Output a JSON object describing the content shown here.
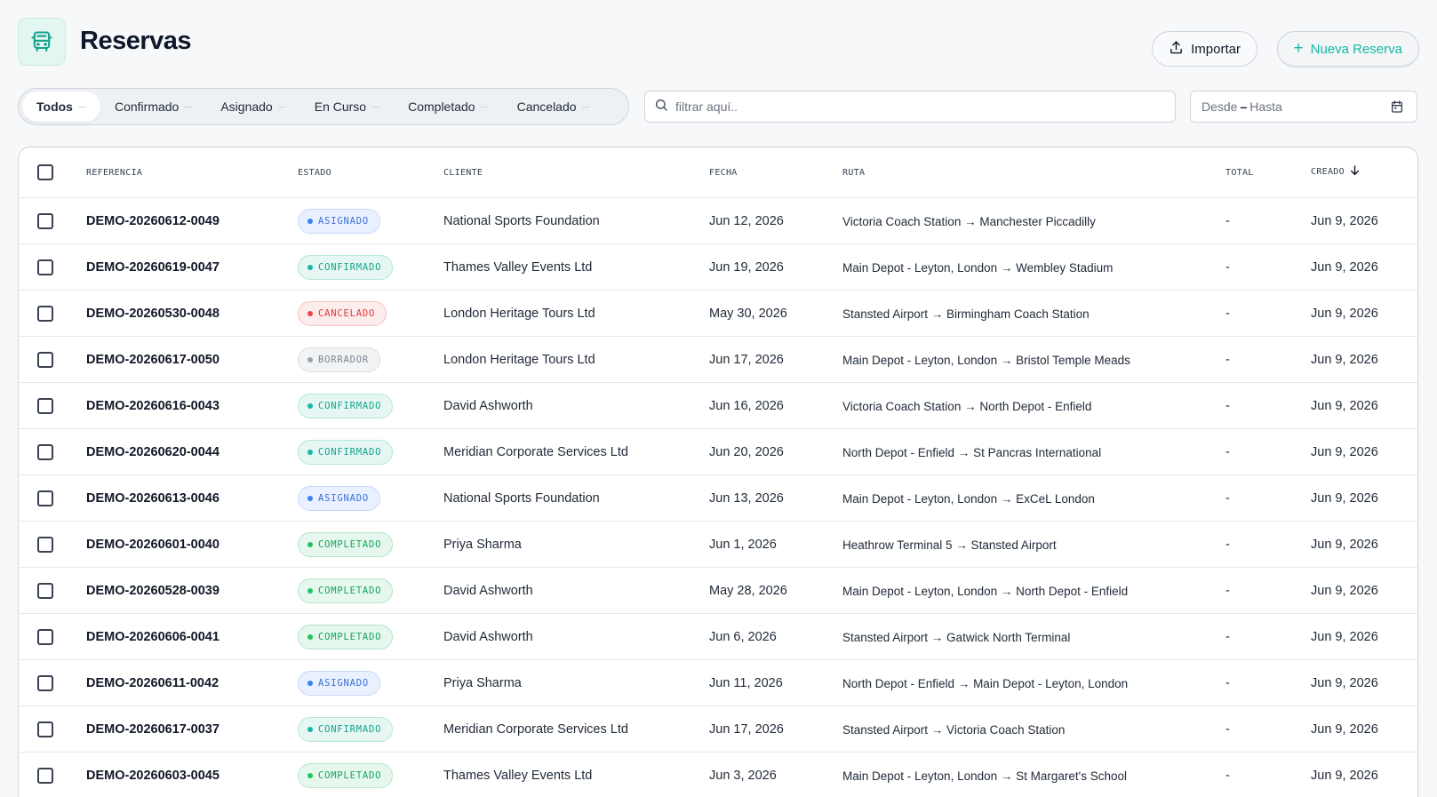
{
  "header": {
    "title": "Reservas",
    "import_label": "Importar",
    "new_label": "Nueva Reserva"
  },
  "tabs": [
    {
      "label": "Todos",
      "active": true
    },
    {
      "label": "Confirmado"
    },
    {
      "label": "Asignado"
    },
    {
      "label": "En Curso"
    },
    {
      "label": "Completado"
    },
    {
      "label": "Cancelado"
    }
  ],
  "search": {
    "placeholder": "filtrar aquí.."
  },
  "daterange": {
    "from_placeholder": "Desde",
    "separator": "–",
    "to_placeholder": "Hasta"
  },
  "table": {
    "columns": {
      "ref": "REFERENCIA",
      "status": "ESTADO",
      "client": "CLIENTE",
      "date": "FECHA",
      "route": "RUTA",
      "total": "TOTAL",
      "created": "CREADO"
    },
    "rows": [
      {
        "ref": "DEMO-20260612-0049",
        "status": "ASIGNADO",
        "status_key": "asignado",
        "client": "National Sports Foundation",
        "date": "Jun 12, 2026",
        "route": "Victoria Coach Station → Manchester Piccadilly",
        "total": "-",
        "created": "Jun 9, 2026"
      },
      {
        "ref": "DEMO-20260619-0047",
        "status": "CONFIRMADO",
        "status_key": "confirmado",
        "client": "Thames Valley Events Ltd",
        "date": "Jun 19, 2026",
        "route": "Main Depot - Leyton, London → Wembley Stadium",
        "total": "-",
        "created": "Jun 9, 2026"
      },
      {
        "ref": "DEMO-20260530-0048",
        "status": "CANCELADO",
        "status_key": "cancelado",
        "client": "London Heritage Tours Ltd",
        "date": "May 30, 2026",
        "route": "Stansted Airport → Birmingham Coach Station",
        "total": "-",
        "created": "Jun 9, 2026"
      },
      {
        "ref": "DEMO-20260617-0050",
        "status": "BORRADOR",
        "status_key": "borrador",
        "client": "London Heritage Tours Ltd",
        "date": "Jun 17, 2026",
        "route": "Main Depot - Leyton, London → Bristol Temple Meads",
        "total": "-",
        "created": "Jun 9, 2026"
      },
      {
        "ref": "DEMO-20260616-0043",
        "status": "CONFIRMADO",
        "status_key": "confirmado",
        "client": "David Ashworth",
        "date": "Jun 16, 2026",
        "route": "Victoria Coach Station → North Depot - Enfield",
        "total": "-",
        "created": "Jun 9, 2026"
      },
      {
        "ref": "DEMO-20260620-0044",
        "status": "CONFIRMADO",
        "status_key": "confirmado",
        "client": "Meridian Corporate Services Ltd",
        "date": "Jun 20, 2026",
        "route": "North Depot - Enfield → St Pancras International",
        "total": "-",
        "created": "Jun 9, 2026"
      },
      {
        "ref": "DEMO-20260613-0046",
        "status": "ASIGNADO",
        "status_key": "asignado",
        "client": "National Sports Foundation",
        "date": "Jun 13, 2026",
        "route": "Main Depot - Leyton, London → ExCeL London",
        "total": "-",
        "created": "Jun 9, 2026"
      },
      {
        "ref": "DEMO-20260601-0040",
        "status": "COMPLETADO",
        "status_key": "completado",
        "client": "Priya Sharma",
        "date": "Jun 1, 2026",
        "route": "Heathrow Terminal 5 → Stansted Airport",
        "total": "-",
        "created": "Jun 9, 2026"
      },
      {
        "ref": "DEMO-20260528-0039",
        "status": "COMPLETADO",
        "status_key": "completado",
        "client": "David Ashworth",
        "date": "May 28, 2026",
        "route": "Main Depot - Leyton, London → North Depot - Enfield",
        "total": "-",
        "created": "Jun 9, 2026"
      },
      {
        "ref": "DEMO-20260606-0041",
        "status": "COMPLETADO",
        "status_key": "completado",
        "client": "David Ashworth",
        "date": "Jun 6, 2026",
        "route": "Stansted Airport → Gatwick North Terminal",
        "total": "-",
        "created": "Jun 9, 2026"
      },
      {
        "ref": "DEMO-20260611-0042",
        "status": "ASIGNADO",
        "status_key": "asignado",
        "client": "Priya Sharma",
        "date": "Jun 11, 2026",
        "route": "North Depot - Enfield → Main Depot - Leyton, London",
        "total": "-",
        "created": "Jun 9, 2026"
      },
      {
        "ref": "DEMO-20260617-0037",
        "status": "CONFIRMADO",
        "status_key": "confirmado",
        "client": "Meridian Corporate Services Ltd",
        "date": "Jun 17, 2026",
        "route": "Stansted Airport → Victoria Coach Station",
        "total": "-",
        "created": "Jun 9, 2026"
      },
      {
        "ref": "DEMO-20260603-0045",
        "status": "COMPLETADO",
        "status_key": "completado",
        "client": "Thames Valley Events Ltd",
        "date": "Jun 3, 2026",
        "route": "Main Depot - Leyton, London → St Margaret's School",
        "total": "-",
        "created": "Jun 9, 2026"
      }
    ]
  },
  "icons": {
    "app": "bus-icon",
    "import": "upload-icon",
    "new": "plus-icon",
    "search": "search-icon",
    "date": "calendar-icon",
    "sort": "arrow-down-icon"
  },
  "colors": {
    "accent": "#14b8a6",
    "asignado": "#3b82f6",
    "confirmado": "#14b8a6",
    "cancelado": "#ef4444",
    "borrador": "#9ca3af",
    "completado": "#22c55e"
  }
}
